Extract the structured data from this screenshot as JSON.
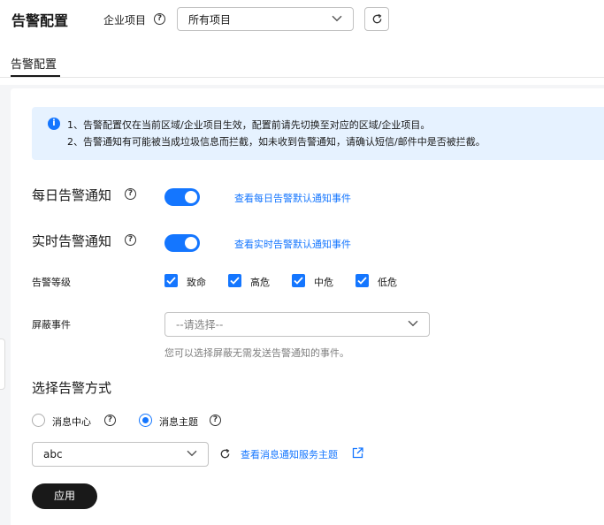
{
  "header": {
    "title": "告警配置",
    "project_label": "企业项目",
    "project_value": "所有项目"
  },
  "tabs": [
    {
      "label": "告警配置",
      "active": true
    }
  ],
  "notice": {
    "line1": "1、告警配置仅在当前区域/企业项目生效，配置前请先切换至对应的区域/企业项目。",
    "line2": "2、告警通知有可能被当成垃圾信息而拦截，如未收到告警通知，请确认短信/邮件中是否被拦截。"
  },
  "daily_notify": {
    "label": "每日告警通知",
    "enabled": true,
    "link": "查看每日告警默认通知事件"
  },
  "realtime_notify": {
    "label": "实时告警通知",
    "enabled": true,
    "link": "查看实时告警默认通知事件"
  },
  "alert_level": {
    "label": "告警等级",
    "options": [
      {
        "label": "致命",
        "checked": true
      },
      {
        "label": "高危",
        "checked": true
      },
      {
        "label": "中危",
        "checked": true
      },
      {
        "label": "低危",
        "checked": true
      }
    ]
  },
  "mask_events": {
    "label": "屏蔽事件",
    "placeholder": "--请选择--",
    "hint": "您可以选择屏蔽无需发送告警通知的事件。"
  },
  "method": {
    "title": "选择告警方式",
    "options": [
      {
        "label": "消息中心",
        "selected": false
      },
      {
        "label": "消息主题",
        "selected": true
      }
    ],
    "topic_value": "abc",
    "topic_link": "查看消息通知服务主题"
  },
  "apply_label": "应用",
  "colors": {
    "primary": "#1476ff",
    "notice_bg": "#e6f2ff",
    "button_dark": "#191919"
  }
}
